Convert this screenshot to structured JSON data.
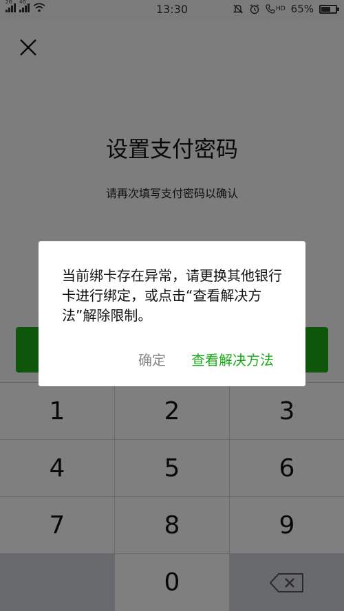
{
  "status_bar": {
    "signal1_tag": "2G",
    "signal2_tag": "4G",
    "time": "13:30",
    "hd_label": "HD",
    "battery_text": "65%",
    "battery_fraction": 0.65
  },
  "page": {
    "title": "设置支付密码",
    "subtitle": "请再次填写支付密码以确认"
  },
  "keypad": {
    "keys": [
      "1",
      "2",
      "3",
      "4",
      "5",
      "6",
      "7",
      "8",
      "9",
      "0"
    ]
  },
  "dialog": {
    "message": "当前绑卡存在异常，请更换其他银行卡进行绑定，或点击“查看解决方法”解除限制。",
    "confirm_label": "确定",
    "solution_label": "查看解决方法"
  },
  "colors": {
    "accent_green": "#1aad19",
    "mask": "rgba(0,0,0,0.5)"
  }
}
